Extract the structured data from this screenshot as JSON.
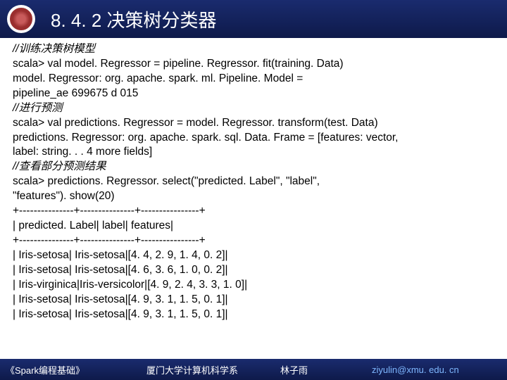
{
  "header": {
    "title": "8. 4. 2 决策树分类器"
  },
  "content": {
    "c1": "//训练决策树模型",
    "l1": "scala> val model. Regressor = pipeline. Regressor. fit(training. Data)",
    "l2": "model. Regressor: org. apache. spark. ml. Pipeline. Model =",
    "l3": "pipeline_ae 699675 d 015",
    "c2": "//进行预测",
    "l4": "scala> val predictions. Regressor = model. Regressor. transform(test. Data)",
    "l5": "predictions. Regressor: org. apache. spark. sql. Data. Frame = [features: vector,",
    "l6": "label: string. . . 4 more fields]",
    "c3": "//查看部分预测结果",
    "l7": "scala> predictions. Regressor. select(\"predicted. Label\", \"label\",",
    "l8": "\"features\"). show(20)",
    "l9": "+---------------+---------------+----------------+",
    "l10": "| predicted. Label| label| features|",
    "l11": "+---------------+---------------+----------------+",
    "l12": "| Iris-setosa| Iris-setosa|[4. 4, 2. 9, 1. 4, 0. 2]|",
    "l13": "| Iris-setosa| Iris-setosa|[4. 6, 3. 6, 1. 0, 0. 2]|",
    "l14": "| Iris-virginica|Iris-versicolor|[4. 9, 2. 4, 3. 3, 1. 0]|",
    "l15": "| Iris-setosa| Iris-setosa|[4. 9, 3. 1, 1. 5, 0. 1]|",
    "l16": "| Iris-setosa| Iris-setosa|[4. 9, 3. 1, 1. 5, 0. 1]|"
  },
  "footer": {
    "book": "《Spark编程基础》",
    "dept": "厦门大学计算机科学系",
    "author": "林子雨",
    "email": "ziyulin@xmu. edu. cn"
  }
}
